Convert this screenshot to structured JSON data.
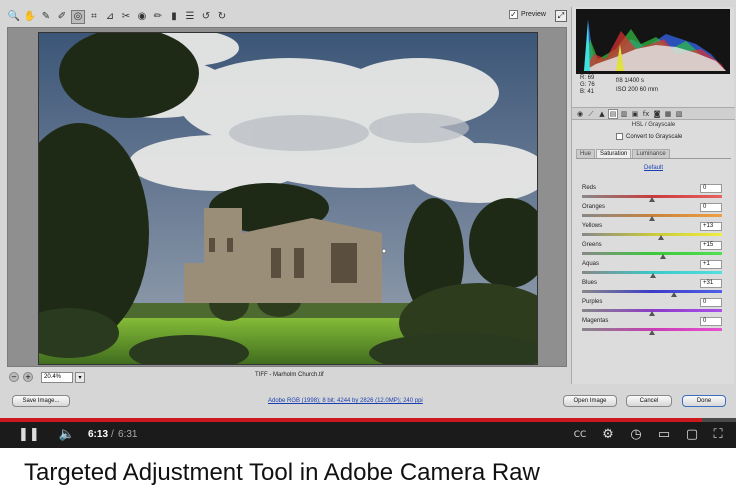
{
  "app": {
    "preview_label": "Preview",
    "preview_checked": "✓",
    "tools": [
      {
        "name": "zoom-tool-icon",
        "glyph": "🔍",
        "active": false
      },
      {
        "name": "hand-tool-icon",
        "glyph": "✋",
        "active": false
      },
      {
        "name": "white-balance-icon",
        "glyph": "✎",
        "active": false
      },
      {
        "name": "color-sampler-icon",
        "glyph": "✐",
        "active": false
      },
      {
        "name": "targeted-adjustment-icon",
        "glyph": "◎",
        "active": true
      },
      {
        "name": "crop-icon",
        "glyph": "⌗",
        "active": false
      },
      {
        "name": "straighten-icon",
        "glyph": "⊿",
        "active": false
      },
      {
        "name": "spot-removal-icon",
        "glyph": "✂",
        "active": false
      },
      {
        "name": "red-eye-icon",
        "glyph": "◉",
        "active": false
      },
      {
        "name": "adjustment-brush-icon",
        "glyph": "✏",
        "active": false
      },
      {
        "name": "graduated-filter-icon",
        "glyph": "▮",
        "active": false
      },
      {
        "name": "preferences-icon",
        "glyph": "☰",
        "active": false
      },
      {
        "name": "rotate-left-icon",
        "glyph": "↺",
        "active": false
      },
      {
        "name": "rotate-right-icon",
        "glyph": "↻",
        "active": false
      }
    ]
  },
  "histogram": {
    "rgb": {
      "r": "R:  69",
      "g": "G:  76",
      "b": "B:  41"
    },
    "camera_line1": "f/8    1/400 s",
    "camera_line2": "ISO 200   60 mm"
  },
  "panel": {
    "section_title": "HSL / Grayscale",
    "convert_label": "Convert to Grayscale",
    "subtabs": [
      "Hue",
      "Saturation",
      "Luminance"
    ],
    "active_subtab": 1,
    "default_label": "Default",
    "sliders": [
      {
        "label": "Reds",
        "value": "0",
        "numeric": 0,
        "colors": [
          "#c83c3c",
          "#e86060"
        ]
      },
      {
        "label": "Oranges",
        "value": "0",
        "numeric": 0,
        "colors": [
          "#c8823c",
          "#f0a040"
        ]
      },
      {
        "label": "Yellows",
        "value": "+13",
        "numeric": 13,
        "colors": [
          "#c8c83c",
          "#eeee40"
        ]
      },
      {
        "label": "Greens",
        "value": "+15",
        "numeric": 15,
        "colors": [
          "#3cc83c",
          "#50e050"
        ]
      },
      {
        "label": "Aquas",
        "value": "+1",
        "numeric": 1,
        "colors": [
          "#3cc8c8",
          "#50e0e0"
        ]
      },
      {
        "label": "Blues",
        "value": "+31",
        "numeric": 31,
        "colors": [
          "#3c3cc8",
          "#5060e8"
        ]
      },
      {
        "label": "Purples",
        "value": "0",
        "numeric": 0,
        "colors": [
          "#8c3cc8",
          "#a850e8"
        ]
      },
      {
        "label": "Magentas",
        "value": "0",
        "numeric": 0,
        "colors": [
          "#c83cb4",
          "#e850d0"
        ]
      }
    ]
  },
  "status": {
    "zoom": "20.4%",
    "filename": "TIFF - Marholm Church.tif"
  },
  "buttons": {
    "save": "Save Image...",
    "workflow": "Adobe RGB (1998); 8 bit; 4244 by 2826 (12.0MP); 240 ppi",
    "open": "Open Image",
    "cancel": "Cancel",
    "done": "Done"
  },
  "player": {
    "current_time": "6:13",
    "separator": "/",
    "total_time": "6:31",
    "progress": 0.954
  },
  "video_title": "Targeted Adjustment Tool in Adobe Camera Raw"
}
